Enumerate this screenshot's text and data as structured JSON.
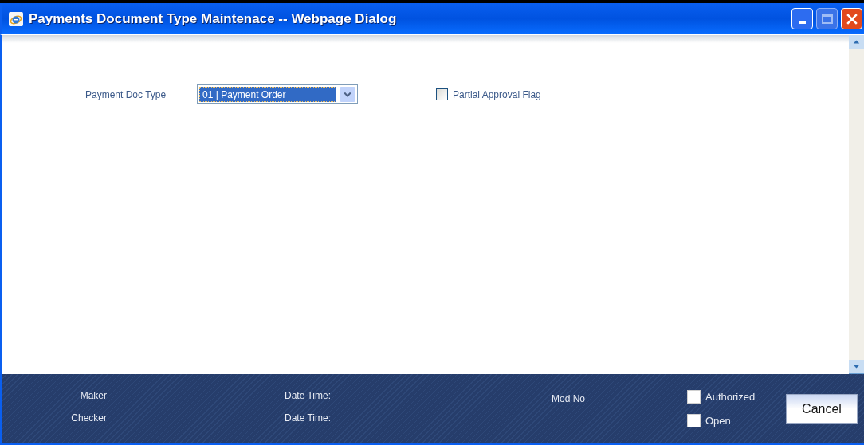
{
  "window": {
    "title": "Payments Document Type Maintenace -- Webpage Dialog"
  },
  "form": {
    "doc_type_label": "Payment Doc Type",
    "doc_type_value": "01 | Payment Order",
    "partial_approval": {
      "label": "Partial Approval Flag",
      "checked": false
    }
  },
  "footer": {
    "maker_label": "Maker",
    "checker_label": "Checker",
    "maker_date_label": "Date Time:",
    "checker_date_label": "Date Time:",
    "mod_no_label": "Mod No",
    "status": [
      {
        "label": "Authorized",
        "checked": false
      },
      {
        "label": "Open",
        "checked": false
      }
    ],
    "cancel_button": "Cancel"
  }
}
